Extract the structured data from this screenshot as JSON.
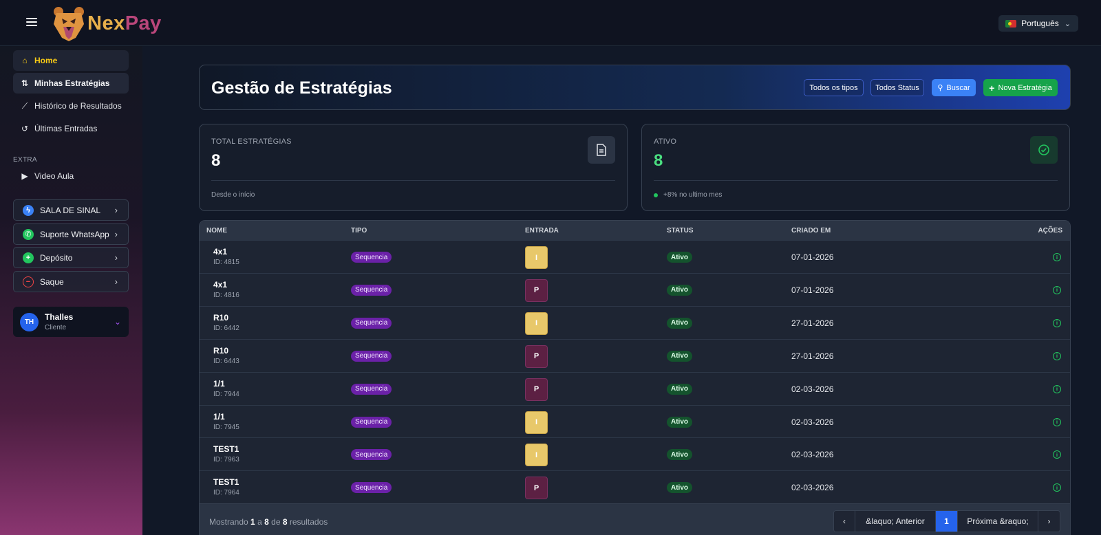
{
  "app": {
    "logo_a": "Nex",
    "logo_b": "Pay",
    "language": "Português"
  },
  "sidebar": {
    "items": [
      {
        "label": "Home",
        "icon": "home-icon"
      },
      {
        "label": "Minhas Estratégias",
        "icon": "strategies-icon"
      },
      {
        "label": "Histórico de Resultados",
        "icon": "chart-line-icon"
      },
      {
        "label": "Últimas Entradas",
        "icon": "history-icon"
      }
    ],
    "extra_label": "EXTRA",
    "extra_items": [
      {
        "label": "Video Aula",
        "icon": "video-icon"
      }
    ],
    "buttons": [
      {
        "label": "SALA DE SINAL",
        "icon": "messenger-icon",
        "color": "#3b82f6"
      },
      {
        "label": "Suporte WhatsApp",
        "icon": "whatsapp-icon",
        "color": "#22c55e"
      },
      {
        "label": "Depósito",
        "icon": "plus-circle-icon",
        "color": "#22c55e"
      },
      {
        "label": "Saque",
        "icon": "minus-circle-icon",
        "color": "#ef4444"
      }
    ],
    "user": {
      "initials": "TH",
      "name": "Thalles",
      "role": "Cliente"
    }
  },
  "header": {
    "title": "Gestão de Estratégias",
    "filter_type": "Todos os tipos",
    "filter_status": "Todos Status",
    "search": "Buscar",
    "new": "Nova Estratégia"
  },
  "stats": {
    "total": {
      "label": "TOTAL ESTRATÉGIAS",
      "value": "8",
      "foot": "Desde o início"
    },
    "active": {
      "label": "ATIVO",
      "value": "8",
      "foot": "+8% no ultimo mes",
      "color": "#4ade80"
    }
  },
  "table": {
    "headers": {
      "name": "NOME",
      "type": "TIPO",
      "entry": "ENTRADA",
      "status": "STATUS",
      "created": "CRIADO EM",
      "actions": "AÇÕES"
    },
    "rows": [
      {
        "name": "4x1",
        "id": "ID: 4815",
        "type": "Sequencia",
        "entry": "I",
        "status": "Ativo",
        "date": "07-01-2026"
      },
      {
        "name": "4x1",
        "id": "ID: 4816",
        "type": "Sequencia",
        "entry": "P",
        "status": "Ativo",
        "date": "07-01-2026"
      },
      {
        "name": "R10",
        "id": "ID: 6442",
        "type": "Sequencia",
        "entry": "I",
        "status": "Ativo",
        "date": "27-01-2026"
      },
      {
        "name": "R10",
        "id": "ID: 6443",
        "type": "Sequencia",
        "entry": "P",
        "status": "Ativo",
        "date": "27-01-2026"
      },
      {
        "name": "1/1",
        "id": "ID: 7944",
        "type": "Sequencia",
        "entry": "P",
        "status": "Ativo",
        "date": "02-03-2026"
      },
      {
        "name": "1/1",
        "id": "ID: 7945",
        "type": "Sequencia",
        "entry": "I",
        "status": "Ativo",
        "date": "02-03-2026"
      },
      {
        "name": "TEST1",
        "id": "ID: 7963",
        "type": "Sequencia",
        "entry": "I",
        "status": "Ativo",
        "date": "02-03-2026"
      },
      {
        "name": "TEST1",
        "id": "ID: 7964",
        "type": "Sequencia",
        "entry": "P",
        "status": "Ativo",
        "date": "02-03-2026"
      }
    ],
    "footer": {
      "showing": "Mostrando",
      "from": "1",
      "a": "a",
      "to": "8",
      "de": "de",
      "total": "8",
      "results": "resultados",
      "prev": "&laquo; Anterior",
      "page": "1",
      "next": "Próxima &raquo;"
    }
  }
}
